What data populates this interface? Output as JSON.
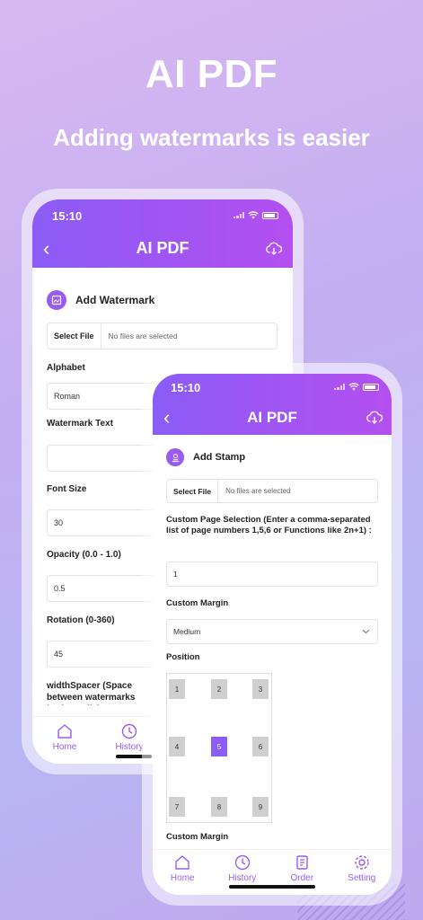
{
  "hero": {
    "title": "AI PDF",
    "subtitle": "Adding watermarks is easier"
  },
  "colors": {
    "accent": "#8b5cf6",
    "accent_end": "#b44ff0"
  },
  "phone1": {
    "time": "15:10",
    "title": "AI PDF",
    "section": "Add Watermark",
    "select_file": "Select File",
    "file_status": "No files are selected",
    "fields": [
      {
        "label": "Alphabet",
        "value": "Roman"
      },
      {
        "label": "Watermark Text",
        "value": ""
      },
      {
        "label": "Font Size",
        "value": "30"
      },
      {
        "label": "Opacity (0.0 - 1.0)",
        "value": "0.5"
      },
      {
        "label": "Rotation (0-360)",
        "value": "45"
      }
    ],
    "spacer_label": "widthSpacer (Space between watermarks horizontally)",
    "tabs": [
      "Home",
      "History"
    ]
  },
  "phone2": {
    "time": "15:10",
    "title": "AI PDF",
    "section": "Add Stamp",
    "select_file": "Select File",
    "file_status": "No files are selected",
    "page_selection_label": "Custom Page Selection (Enter a comma-separated list of page numbers 1,5,6 or Functions like 2n+1) :",
    "page_selection_value": "1",
    "custom_margin_label": "Custom Margin",
    "custom_margin_value": "Medium",
    "position_label": "Position",
    "positions": [
      "1",
      "2",
      "3",
      "4",
      "5",
      "6",
      "7",
      "8",
      "9"
    ],
    "selected_position": "5",
    "custom_margin_label_2": "Custom Margin",
    "tabs": [
      "Home",
      "History",
      "Order",
      "Setting"
    ]
  }
}
